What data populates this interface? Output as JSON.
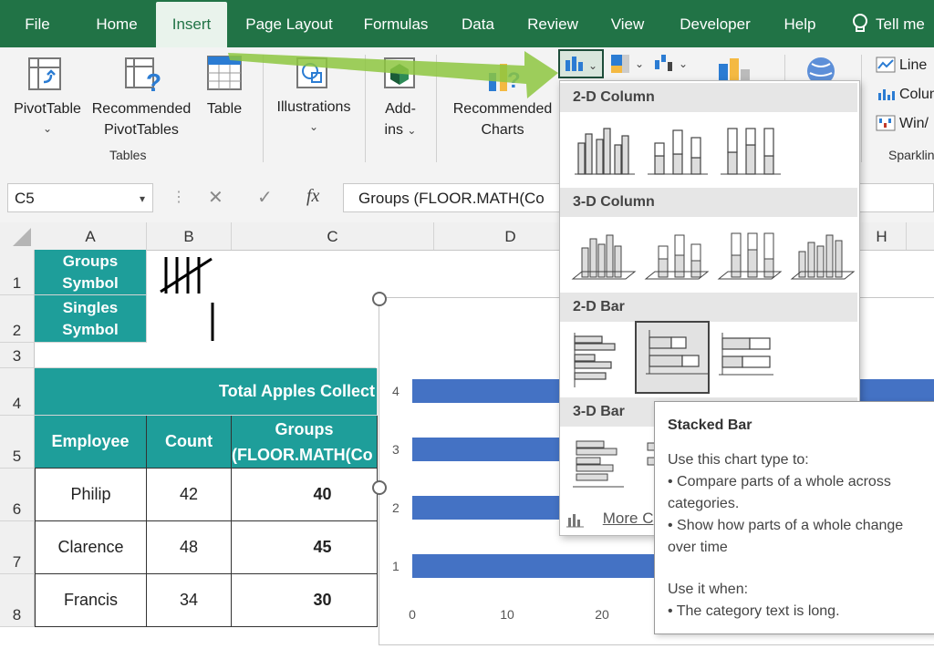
{
  "tabs": [
    {
      "label": "File"
    },
    {
      "label": "Home"
    },
    {
      "label": "Insert"
    },
    {
      "label": "Page Layout"
    },
    {
      "label": "Formulas"
    },
    {
      "label": "Data"
    },
    {
      "label": "Review"
    },
    {
      "label": "View"
    },
    {
      "label": "Developer"
    },
    {
      "label": "Help"
    },
    {
      "label": "Tell me"
    }
  ],
  "ribbon": {
    "pivot_line1": "PivotTable",
    "recpivot_line1": "Recommended",
    "recpivot_line2": "PivotTables",
    "table_label": "Table",
    "tables_group": "Tables",
    "illustrations_label": "Illustrations",
    "addins_line1": "Add-",
    "addins_line2": "ins",
    "rec_charts_line1": "Recommended",
    "rec_charts_line2": "Charts",
    "spark_line": "Line",
    "spark_column": "Colum",
    "spark_winloss": "Win/",
    "sparklines_group": "Sparklin"
  },
  "formula_bar": {
    "name_box": "C5",
    "formula": "Groups (FLOOR.MATH(Co"
  },
  "columns": [
    "A",
    "B",
    "C",
    "D",
    "H"
  ],
  "rows": [
    "1",
    "2",
    "3",
    "4",
    "5",
    "6",
    "7",
    "8"
  ],
  "sheet": {
    "groups_symbol_1": "Groups",
    "groups_symbol_2": "Symbol",
    "singles_symbol_1": "Singles",
    "singles_symbol_2": "Symbol",
    "title": "Total Apples Collect",
    "header_employee": "Employee",
    "header_count": "Count",
    "header_groups_1": "Groups",
    "header_groups_2": "(FLOOR.MATH(Co",
    "data": [
      {
        "employee": "Philip",
        "count": "42",
        "groups": "40"
      },
      {
        "employee": "Clarence",
        "count": "48",
        "groups": "45"
      },
      {
        "employee": "Francis",
        "count": "34",
        "groups": "30"
      }
    ]
  },
  "chart_data": {
    "type": "bar",
    "categories": [
      "1",
      "2",
      "3",
      "4"
    ],
    "x_ticks": [
      "0",
      "10",
      "20"
    ],
    "bar_color": "#4472c4"
  },
  "dropdown": {
    "section_2d_column": "2-D Column",
    "section_3d_column": "3-D Column",
    "section_2d_bar": "2-D Bar",
    "section_3d_bar": "3-D Bar",
    "more_charts": "More C"
  },
  "tooltip": {
    "title": "Stacked Bar",
    "intro": "Use this chart type to:",
    "bullet1": "• Compare parts of a whole across categories.",
    "bullet2": "• Show how parts of a whole change over time",
    "when": "Use it when:",
    "bullet3": "• The category text is long."
  },
  "colors": {
    "ribbon_green": "#217346",
    "teal_header": "#1e9e9a",
    "arrow_green": "#8dc63f",
    "bar_blue": "#4472c4"
  }
}
